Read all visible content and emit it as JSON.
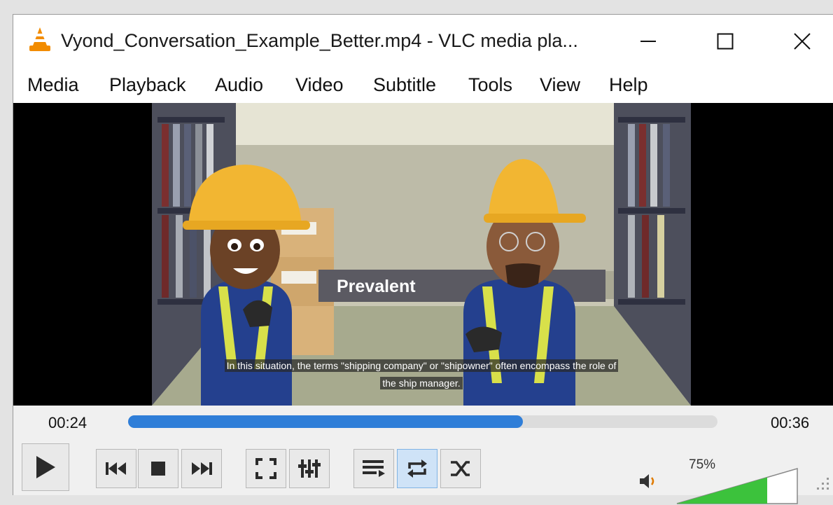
{
  "window": {
    "title": "Vyond_Conversation_Example_Better.mp4 - VLC media pla...",
    "app_icon": "vlc-cone-icon"
  },
  "menu": [
    "Media",
    "Playback",
    "Audio",
    "Video",
    "Subtitle",
    "Tools",
    "View",
    "Help"
  ],
  "video": {
    "overlay_text": "Prevalent",
    "subtitle_line1": "In this situation, the terms \"shipping company\" or \"shipowner\" often encompass the role of",
    "subtitle_line2": "the ship manager."
  },
  "playback": {
    "elapsed": "00:24",
    "total": "00:36",
    "progress": 0.67
  },
  "controls": {
    "buttons": [
      "play-icon",
      "previous-icon",
      "stop-icon",
      "next-icon",
      "fullscreen-icon",
      "extended-settings-icon",
      "playlist-icon",
      "loop-icon",
      "shuffle-icon"
    ],
    "loop_active": true
  },
  "volume": {
    "label": "75%",
    "level": 0.75,
    "accent": "#3cc23c"
  },
  "colors": {
    "seek_fill": "#2f7ed8",
    "subtitle_bg": "#282828"
  }
}
